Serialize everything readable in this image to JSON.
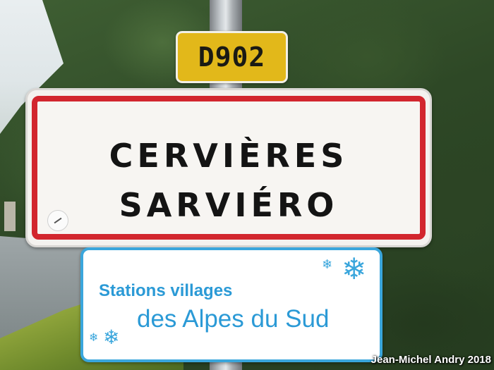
{
  "road_sign": {
    "number": "D902"
  },
  "town_sign": {
    "line1": "CERVIÈRES",
    "line2": "SARVIÉRO"
  },
  "station_sign": {
    "line1": "Stations villages",
    "line2": "des Alpes du Sud"
  },
  "credit": "Jean-Michel Andry 2018",
  "icons": [
    "snowflake-icon"
  ],
  "colors": {
    "border_red": "#d2262e",
    "station_blue": "#3aa6dc",
    "road_yellow": "#e2b81a"
  }
}
